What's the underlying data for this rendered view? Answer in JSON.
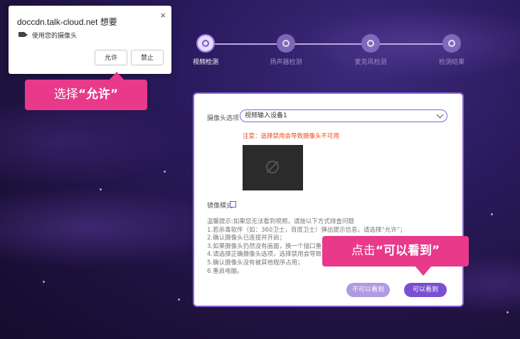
{
  "permission_popup": {
    "title": "doccdn.talk-cloud.net 想要",
    "close_glyph": "×",
    "request_text": "使用您的摄像头",
    "allow_label": "允许",
    "block_label": "禁止"
  },
  "callouts": {
    "allow_prefix": "选择",
    "allow_emphasis": "“允许”",
    "see_prefix": "点击",
    "see_emphasis": "“可以看到”"
  },
  "steps": [
    {
      "label": "视频检测",
      "active": true,
      "icon": "camera-icon"
    },
    {
      "label": "扬声器检测",
      "active": false,
      "icon": "headphones-icon"
    },
    {
      "label": "麦克风检测",
      "active": false,
      "icon": "microphone-icon"
    },
    {
      "label": "检测结果",
      "active": false,
      "icon": "result-icon"
    }
  ],
  "panel": {
    "camera_option_label": "摄像头选项",
    "camera_selected": "视频输入设备1",
    "warning": "注意：选择禁用会导致摄像头不可用",
    "mirror_label": "镜像模式",
    "tips": [
      "温馨提示:如果您无法看到视频，请按以下方式排查问题",
      "1.若杀毒软件（如：360卫士，百度卫士）弹出提示信息，请选择“允许”；",
      "2.确认摄像头已连接并开启；",
      "3.如果摄像头仍然没有画面，换一个插口重",
      "4.请选择正确摄像头选项，选择禁用会导致",
      "5.确认摄像头没有被其他程序占用；",
      "6.重启电脑。"
    ],
    "cannot_see_label": "不可以看到",
    "can_see_label": "可以看到"
  },
  "colors": {
    "accent": "#7a4fd0",
    "callout": "#e8398a",
    "warning": "#e84a1a"
  }
}
